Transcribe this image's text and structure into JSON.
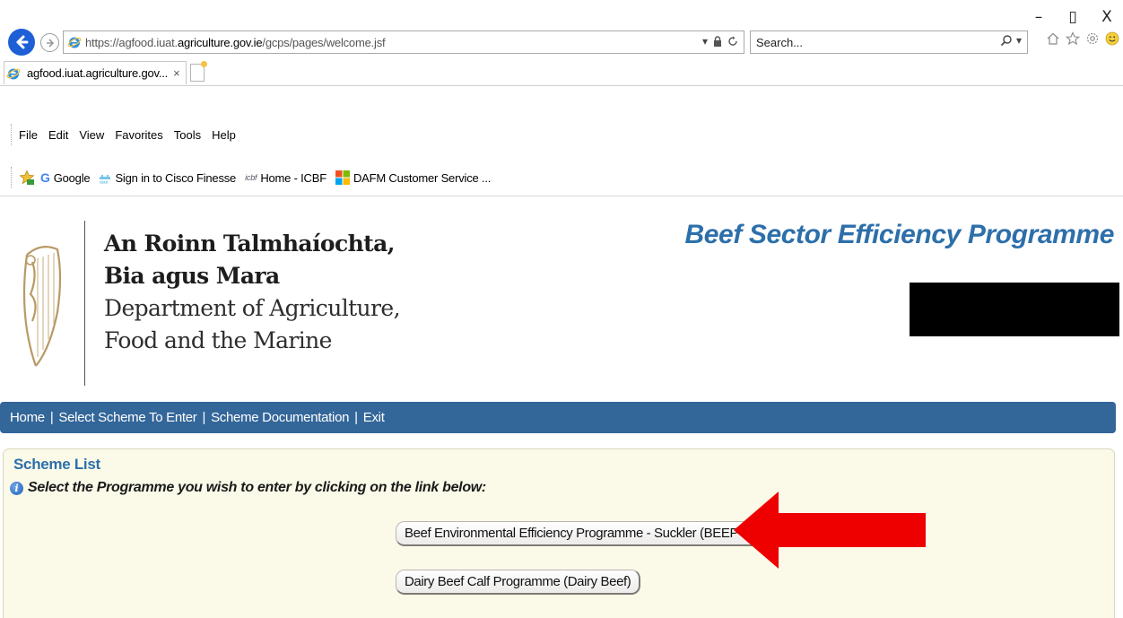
{
  "window": {
    "minimize": "–",
    "restore": "▯",
    "close": "X"
  },
  "browser": {
    "url_prefix": "https://agfood.iuat.",
    "url_domain": "agriculture.gov.ie",
    "url_path": "/gcps/pages/welcome.jsf",
    "search_placeholder": "Search...",
    "tab_title": "agfood.iuat.agriculture.gov...",
    "tab_close": "×",
    "menu": [
      "File",
      "Edit",
      "View",
      "Favorites",
      "Tools",
      "Help"
    ],
    "favorites": [
      {
        "label": "Google",
        "icon": "google-icon"
      },
      {
        "label": "Sign in to Cisco Finesse",
        "icon": "cisco-icon"
      },
      {
        "label": "Home - ICBF",
        "icon": "icbf-icon"
      },
      {
        "label": "DAFM Customer Service ...",
        "icon": "windows-tiles-icon"
      }
    ],
    "accent": "#1e5fd6"
  },
  "header": {
    "dept_irish_line1": "An Roinn Talmhaíochta,",
    "dept_irish_line2": "Bia agus Mara",
    "dept_english_line1": "Department of Agriculture,",
    "dept_english_line2": "Food and the Marine",
    "programme_title": "Beef Sector Efficiency Programme",
    "title_color": "#2d6faa"
  },
  "nav": {
    "items": [
      "Home",
      "Select Scheme To Enter",
      "Scheme Documentation",
      "Exit"
    ],
    "separator": "|",
    "bar_color": "#336699"
  },
  "scheme_list": {
    "title": "Scheme List",
    "instruction": "Select the Programme you wish to enter by clicking on the link below:",
    "schemes": [
      "Beef Environmental Efficiency Programme - Suckler (BEEP-S)",
      "Dairy Beef Calf Programme (Dairy Beef)"
    ],
    "panel_color": "#fbfae9",
    "arrow_color": "#ee0000"
  }
}
